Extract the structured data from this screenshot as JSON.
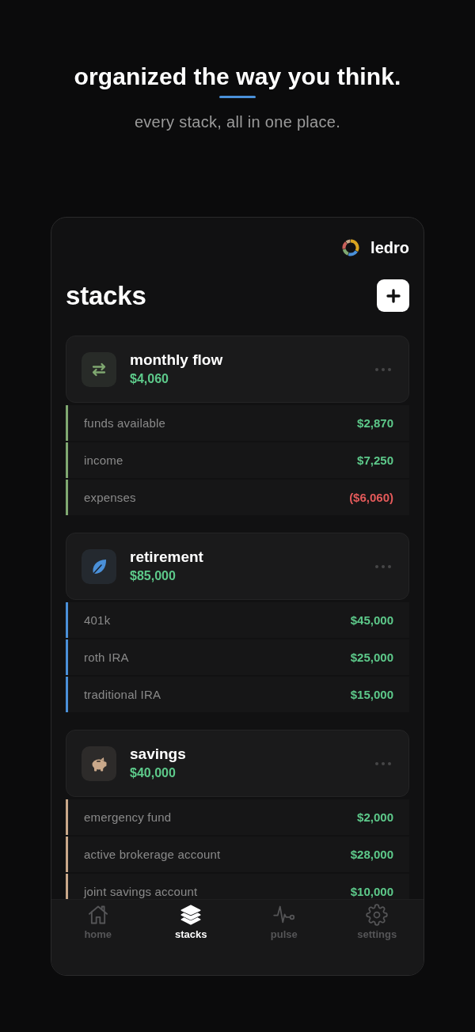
{
  "hero": {
    "title": "organized the way you think.",
    "subtitle": "every stack, all in one place."
  },
  "app": {
    "brand": "ledro",
    "title": "stacks"
  },
  "stacks": [
    {
      "name": "monthly flow",
      "kind": "flow",
      "color": "#7fa870",
      "total": "$4,060",
      "accounts": [
        {
          "name": "funds available",
          "balance": "$2,870",
          "negative": false
        },
        {
          "name": "income",
          "balance": "$7,250",
          "negative": false
        },
        {
          "name": "expenses",
          "balance": "($6,060)",
          "negative": true
        }
      ]
    },
    {
      "name": "retirement",
      "kind": "retirement",
      "color": "#4a90d9",
      "total": "$85,000",
      "accounts": [
        {
          "name": "401k",
          "balance": "$45,000",
          "negative": false
        },
        {
          "name": "roth IRA",
          "balance": "$25,000",
          "negative": false
        },
        {
          "name": "traditional IRA",
          "balance": "$15,000",
          "negative": false
        }
      ]
    },
    {
      "name": "savings",
      "kind": "savings",
      "color": "#c9a88a",
      "total": "$40,000",
      "accounts": [
        {
          "name": "emergency fund",
          "balance": "$2,000",
          "negative": false
        },
        {
          "name": "active brokerage account",
          "balance": "$28,000",
          "negative": false
        },
        {
          "name": "joint savings account",
          "balance": "$10,000",
          "negative": false
        }
      ]
    }
  ],
  "nav": [
    {
      "label": "home",
      "kind": "home",
      "selected": false
    },
    {
      "label": "stacks",
      "kind": "stacks",
      "selected": true
    },
    {
      "label": "pulse",
      "kind": "pulse",
      "selected": false
    },
    {
      "label": "settings",
      "kind": "settings",
      "selected": false
    }
  ]
}
